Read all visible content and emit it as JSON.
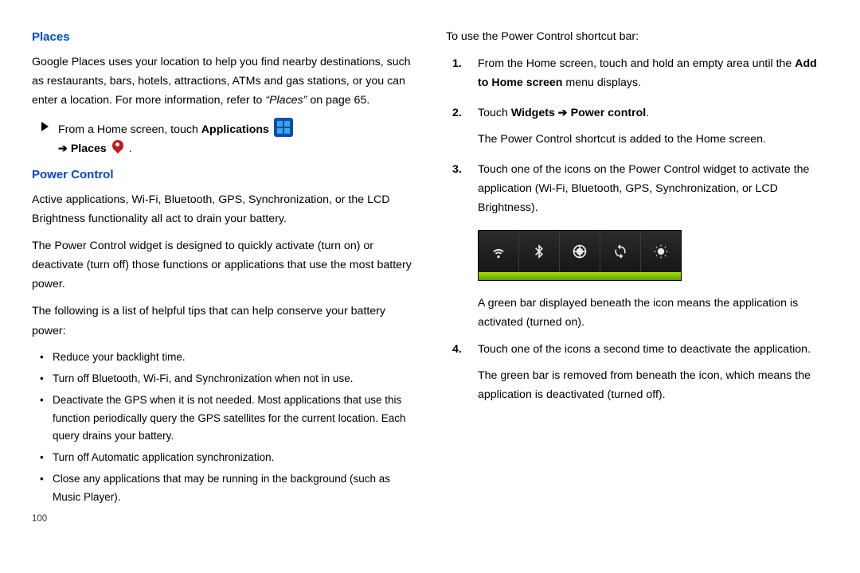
{
  "pageNumber": "100",
  "left": {
    "h_places": "Places",
    "places_p": "Google Places uses your location to help you find nearby destinations, such as restaurants, bars, hotels, attractions, ATMs and gas stations, or you can enter a location. For more information, refer to ",
    "places_ref": "“Places”",
    "places_ref_tail": "  on page 65.",
    "step_pre": "From a Home screen, touch ",
    "step_apps": "Applications",
    "step_arrow": " ➔ ",
    "step_places": "Places",
    "step_end": " .",
    "h_power": "Power Control",
    "pc_p1": "Active applications, Wi-Fi, Bluetooth, GPS, Synchronization, or the LCD Brightness functionality all act to drain your battery.",
    "pc_p2": "The Power Control widget is designed to quickly activate (turn on) or deactivate (turn off) those functions or applications that use the most battery power.",
    "pc_p3": "The following is a list of helpful tips that can help conserve your battery power:",
    "tips": [
      "Reduce your backlight time.",
      "Turn off Bluetooth, Wi-Fi, and Synchronization when not in use.",
      "Deactivate the GPS when it is not needed. Most applications that use this function periodically query the GPS satellites for the current location. Each query drains your battery.",
      "Turn off Automatic application synchronization.",
      "Close any applications that may be running in the background (such as Music Player)."
    ]
  },
  "right": {
    "intro": "To use the Power Control shortcut bar:",
    "s1a": "From the Home screen, touch and hold an empty area until the ",
    "s1b": "Add to Home screen",
    "s1c": " menu displays.",
    "s2a": "Touch ",
    "s2b": "Widgets",
    "s2arrow": " ➔ ",
    "s2c": "Power control",
    "s2end": ".",
    "s2p": "The Power Control shortcut is added to the Home screen.",
    "s3a": "Touch one of the icons on the Power Control widget to activate the application (Wi-Fi, Bluetooth, GPS, Synchronization, or LCD Brightness).",
    "s3p": "A green bar displayed beneath the icon means the application is activated (turned on).",
    "s4a": "Touch one of the icons a second time to deactivate the application.",
    "s4p": "The green bar is removed from beneath the icon, which means the application is deactivated (turned off).",
    "toggles": [
      "wifi-icon",
      "bluetooth-icon",
      "gps-icon",
      "sync-icon",
      "brightness-icon"
    ]
  }
}
